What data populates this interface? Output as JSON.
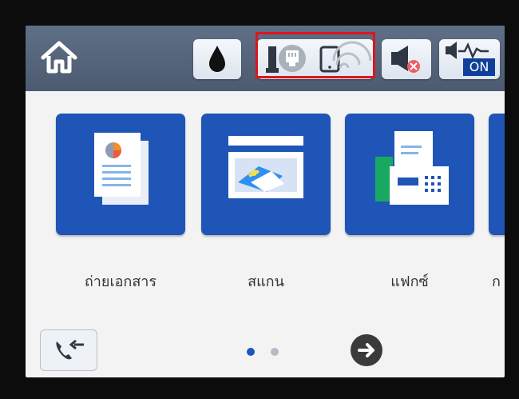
{
  "header": {
    "home_icon": "home-icon",
    "status_icons": [
      "ink-drop-icon",
      "ethernet-icon",
      "wifi-direct-icon",
      "speaker-mute-icon",
      "quiet-mode-on-icon"
    ],
    "quiet_mode_label": "ON"
  },
  "main": {
    "tiles": [
      {
        "label": "ถ่ายเอกสาร",
        "icon": "copy-icon"
      },
      {
        "label": "สแกน",
        "icon": "scan-icon"
      },
      {
        "label": "แฟกซ์",
        "icon": "fax-icon"
      },
      {
        "label": "ก",
        "icon": "more-icon"
      }
    ]
  },
  "footer": {
    "left_icon": "phone-transfer-icon",
    "page_indicator": {
      "current": 1,
      "total": 2
    },
    "next_icon": "arrow-right-icon"
  },
  "colors": {
    "tile_blue": "#1f55b6",
    "topbar_slate": "#55647a",
    "highlight_red": "#e0141d"
  }
}
